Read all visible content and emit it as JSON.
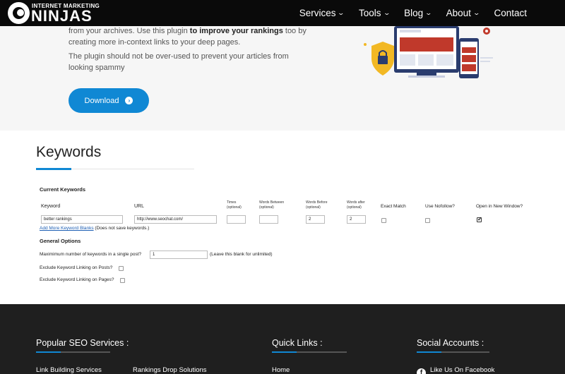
{
  "header": {
    "logo_small": "INTERNET MARKETING",
    "logo_big": "NINJAS",
    "nav": [
      {
        "label": "Services",
        "has_dropdown": true
      },
      {
        "label": "Tools",
        "has_dropdown": true
      },
      {
        "label": "Blog",
        "has_dropdown": true
      },
      {
        "label": "About",
        "has_dropdown": true
      },
      {
        "label": "Contact",
        "has_dropdown": false
      }
    ]
  },
  "hero": {
    "p1_pre": "from your archives. Use this plugin ",
    "p1_bold": "to improve your rankings",
    "p1_post": " too by creating more in-context links to your deep pages.",
    "p2": "The plugin should not be over-used to prevent your articles from looking spammy",
    "download_label": "Download"
  },
  "keywords": {
    "title": "Keywords",
    "current_heading": "Current Keywords",
    "columns": {
      "keyword": "Keyword",
      "url": "URL",
      "times": "Times",
      "times_sub": "(optional)",
      "words_between": "Words Between",
      "words_between_sub": "(optional)",
      "words_before": "Words Before",
      "words_before_sub": "(optional)",
      "words_after": "Words after",
      "words_after_sub": "(optional)",
      "exact_match": "Exact Match",
      "use_nofollow": "Use Nofollow?",
      "open_new_window": "Open in New Window?"
    },
    "row": {
      "keyword": "better rankings",
      "url": "http://www.seochat.com/",
      "times": "",
      "words_between": "",
      "words_before": "2",
      "words_after": "2",
      "exact_match": false,
      "use_nofollow": false,
      "open_new_window": true
    },
    "add_more_link": "Add More Keyword Blanks",
    "add_more_note": "(Does not save keywords.)",
    "general_heading": "General Options",
    "max_keywords_label": "Maximimum number of keywords in a single post?",
    "max_keywords_value": "1",
    "max_keywords_note": "(Leave this blank for unlimited)",
    "exclude_posts_label": "Exclude Keyword Linking on Posts?",
    "exclude_pages_label": "Exclude Keyword Linking on Pages?"
  },
  "footer": {
    "col1_heading": "Popular SEO Services :",
    "col2_heading": "Quick Links :",
    "col3_heading": "Social Accounts :",
    "col1_link1": "Link Building Services",
    "col1_link2": "Rankings Drop Solutions",
    "col2_link1": "Home",
    "col3_link1": "Like Us On Facebook"
  },
  "colors": {
    "accent": "#1088d4",
    "header_bg": "#0a0a0a",
    "footer_bg": "#1f1f1f",
    "hero_bg": "#f6f6f6"
  }
}
